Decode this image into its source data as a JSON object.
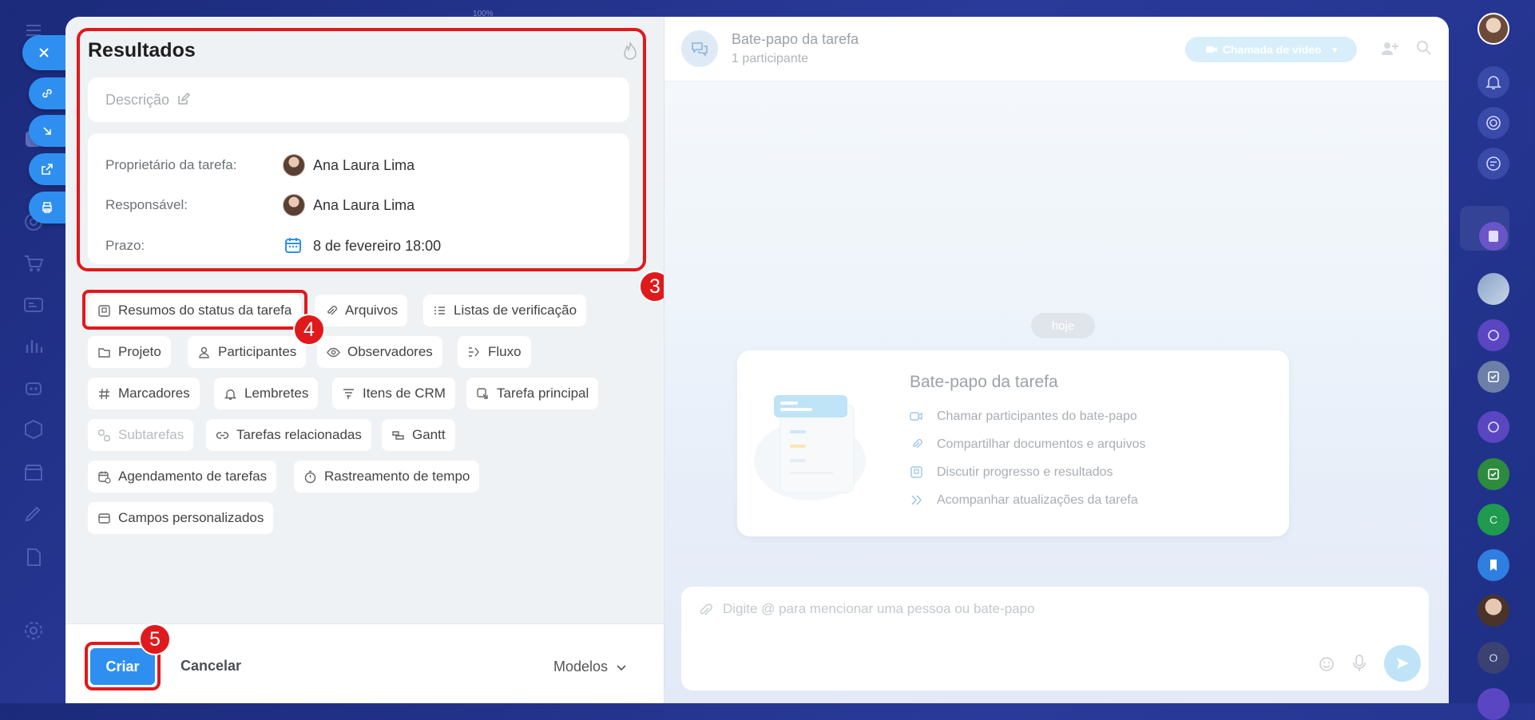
{
  "zoom_text": "100%",
  "results": {
    "title": "Resultados",
    "description_placeholder": "Descrição",
    "owner_label": "Proprietário da tarefa:",
    "owner_name": "Ana Laura Lima",
    "responsible_label": "Responsável:",
    "responsible_name": "Ana Laura Lima",
    "deadline_label": "Prazo:",
    "deadline_value": "8 de fevereiro 18:00"
  },
  "chips": [
    {
      "label": "Resumos do status da tarefa",
      "icon": "status-summary-icon"
    },
    {
      "label": "Arquivos",
      "icon": "paperclip-icon"
    },
    {
      "label": "Listas de verificação",
      "icon": "checklist-icon"
    },
    {
      "label": "Projeto",
      "icon": "folder-icon"
    },
    {
      "label": "Participantes",
      "icon": "person-icon"
    },
    {
      "label": "Observadores",
      "icon": "eye-icon"
    },
    {
      "label": "Fluxo",
      "icon": "flow-icon"
    },
    {
      "label": "Marcadores",
      "icon": "hash-icon"
    },
    {
      "label": "Lembretes",
      "icon": "bell-icon"
    },
    {
      "label": "Itens de CRM",
      "icon": "crm-icon"
    },
    {
      "label": "Tarefa principal",
      "icon": "parent-task-icon"
    },
    {
      "label": "Subtarefas",
      "icon": "subtask-icon"
    },
    {
      "label": "Tarefas relacionadas",
      "icon": "link-icon"
    },
    {
      "label": "Gantt",
      "icon": "gantt-icon"
    },
    {
      "label": "Agendamento de tarefas",
      "icon": "calendar-schedule-icon"
    },
    {
      "label": "Rastreamento de tempo",
      "icon": "stopwatch-icon"
    },
    {
      "label": "Campos personalizados",
      "icon": "custom-fields-icon"
    }
  ],
  "markers": {
    "m3": "3",
    "m4": "4",
    "m5": "5"
  },
  "footer": {
    "create": "Criar",
    "cancel": "Cancelar",
    "templates": "Modelos"
  },
  "chat": {
    "title": "Bate-papo da tarefa",
    "subtitle": "1 participante",
    "video_call": "Chamada de vídeo",
    "today": "hoje",
    "intro_title": "Bate-papo da tarefa",
    "intro_items": [
      "Chamar participantes do bate-papo",
      "Compartilhar documentos e arquivos",
      "Discutir progresso e resultados",
      "Acompanhar atualizações da tarefa"
    ],
    "composer_placeholder": "Digite @ para mencionar uma pessoa ou bate-papo"
  },
  "right_rail": {
    "avatar_c": "C",
    "avatar_o": "O"
  },
  "colors": {
    "accent": "#2f8ff0",
    "marker": "#e0191c"
  }
}
